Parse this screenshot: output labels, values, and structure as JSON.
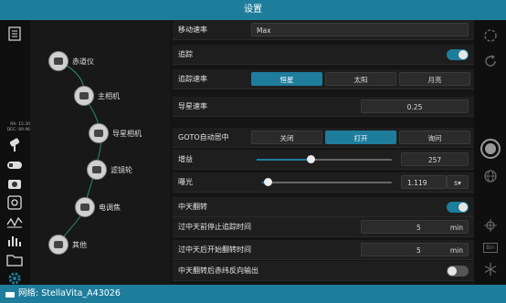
{
  "window": {
    "title": "设置"
  },
  "status": {
    "network": "网络: StellaVita_A43026"
  },
  "left_toolbar": {
    "ra_label": "RA:",
    "ra_value": "15.30",
    "dec_label": "DEC:",
    "dec_value": "89.96",
    "icons": [
      "checklist-icon",
      "mount-icon",
      "telescope-icon",
      "camera-icon",
      "target-icon",
      "graph-icon",
      "histogram-icon",
      "folder-icon",
      "settings-icon"
    ]
  },
  "device_tree": {
    "items": [
      {
        "label": "赤道仪",
        "icon": "mount-icon"
      },
      {
        "label": "主相机",
        "icon": "main-camera-icon"
      },
      {
        "label": "导星相机",
        "icon": "guide-camera-icon"
      },
      {
        "label": "滤镜轮",
        "icon": "filter-wheel-icon"
      },
      {
        "label": "电调焦",
        "icon": "focuser-icon"
      },
      {
        "label": "其他",
        "icon": "other-icon"
      }
    ]
  },
  "settings": {
    "slew_rate": {
      "label": "移动速率",
      "value": "Max"
    },
    "tracking": {
      "label": "追踪",
      "on": true
    },
    "tracking_rate": {
      "label": "追踪速率",
      "options": [
        "恒星",
        "太阳",
        "月亮"
      ],
      "selected": "恒星"
    },
    "guide_rate": {
      "label": "导星速率",
      "value": "0.25"
    },
    "goto_center": {
      "label": "GOTO自动居中",
      "options": [
        "关闭",
        "打开",
        "询问"
      ],
      "selected": "打开"
    },
    "gain": {
      "label": "增益",
      "value": "257",
      "level_fraction": 0.4
    },
    "exposure": {
      "label": "曝光",
      "value": "1.119",
      "unit": "s"
    },
    "meridian_flip": {
      "label": "中天翻转",
      "on": true
    },
    "stop_before": {
      "label": "过中天前停止追踪时间",
      "value": "5",
      "unit": "min"
    },
    "flip_after": {
      "label": "过中天后开始翻转时间",
      "value": "5",
      "unit": "min"
    },
    "reverse_dec": {
      "label": "中天翻转后赤纬反向输出",
      "on": false
    }
  },
  "right_toolbar": {
    "icons": [
      "rotate-icon",
      "refresh-icon",
      "shutter-button",
      "globe-icon",
      "crosshair-icon",
      "bin-icon",
      "snowflake-icon"
    ],
    "bin_label": "Bin"
  },
  "colors": {
    "accent": "#1f7d9c",
    "bg": "#141414"
  }
}
